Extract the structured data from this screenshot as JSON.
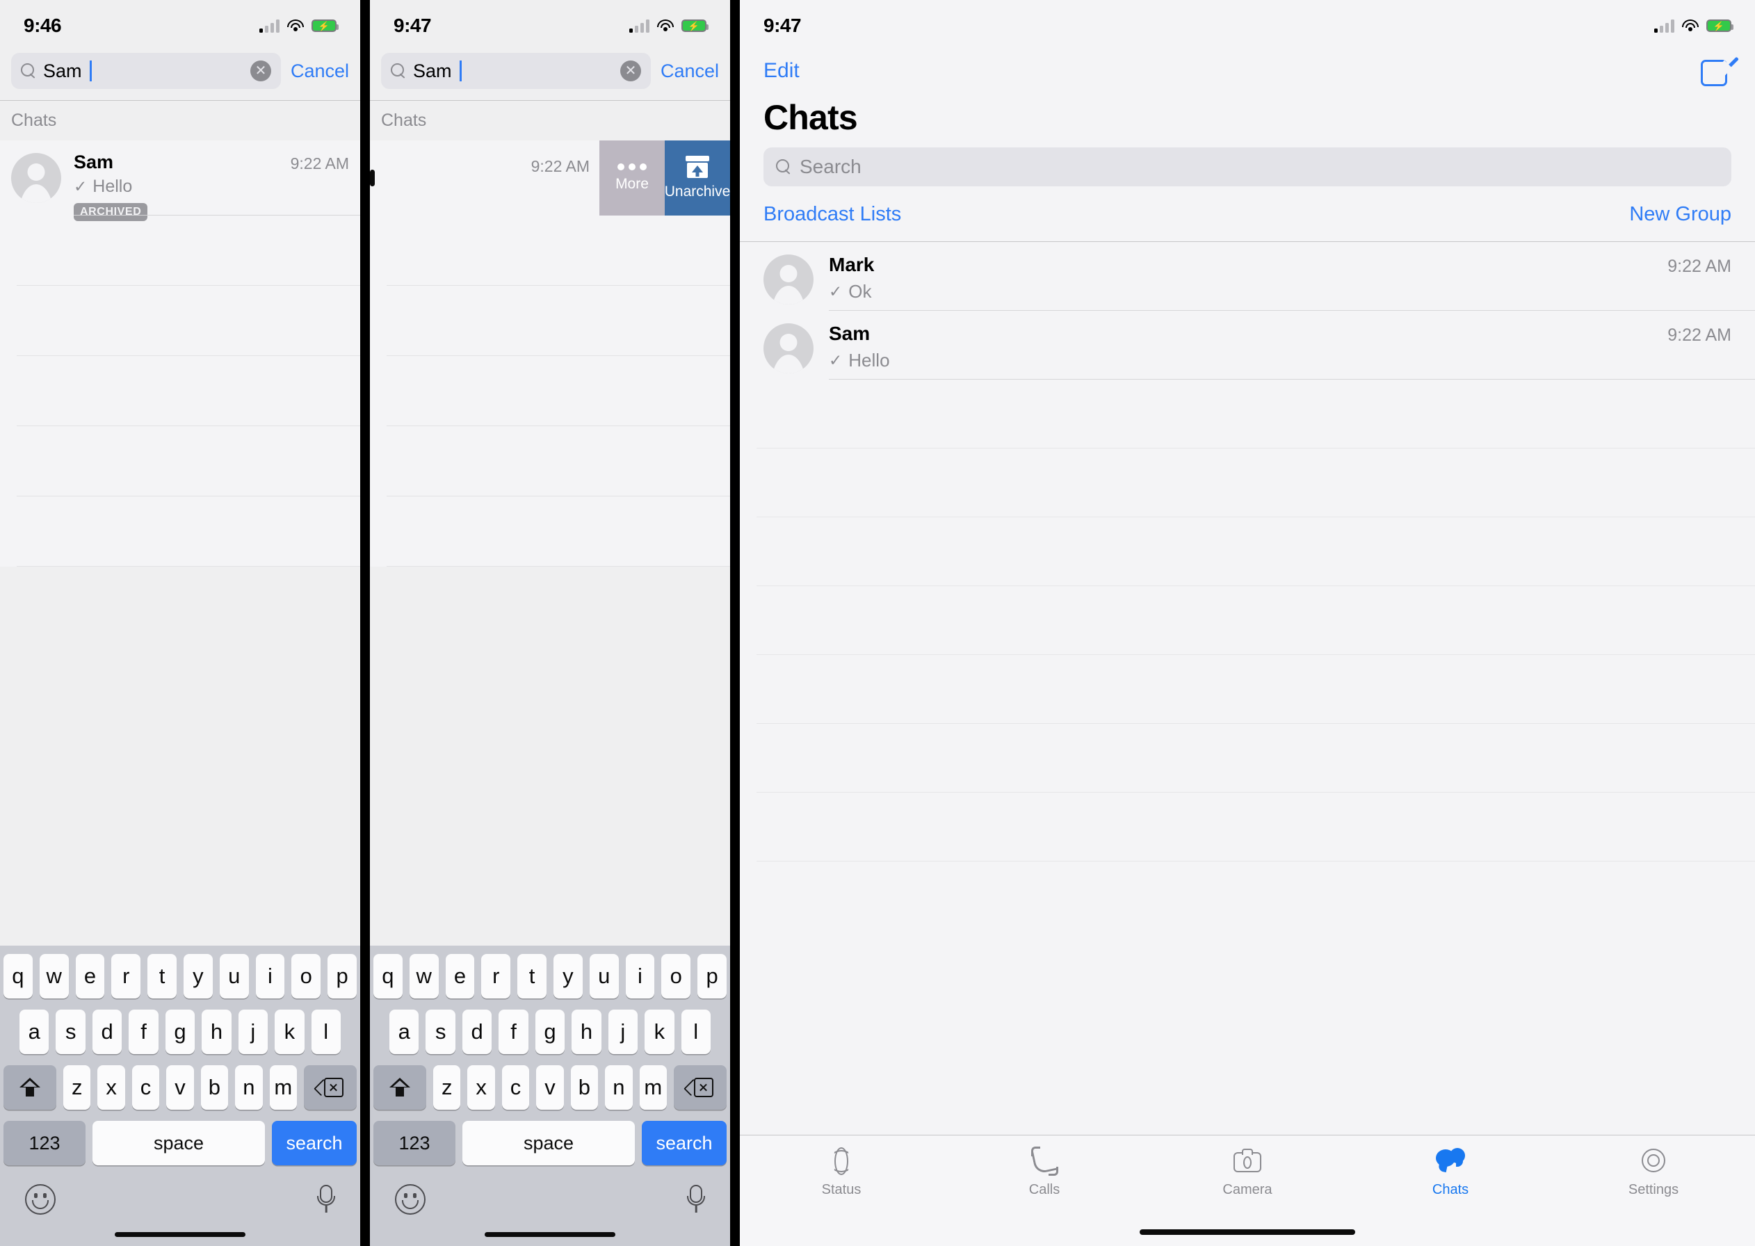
{
  "panel1": {
    "status_bar": {
      "time": "9:46",
      "cell_icon": "cellular-bars-icon",
      "wifi_icon": "wifi-icon",
      "battery_icon": "battery-charging-icon"
    },
    "search": {
      "value": "Sam",
      "icon": "search-icon",
      "clear_icon": "clear-icon",
      "cancel_label": "Cancel"
    },
    "section_header": "Chats",
    "result": {
      "name": "Sam",
      "message": "Hello",
      "tick_icon": "check-icon",
      "time": "9:22 AM",
      "badge": "ARCHIVED",
      "avatar": "person-avatar-icon"
    }
  },
  "panel2": {
    "status_bar": {
      "time": "9:47",
      "cell_icon": "cellular-bars-icon",
      "wifi_icon": "wifi-icon",
      "battery_icon": "battery-charging-icon"
    },
    "search": {
      "value": "Sam",
      "icon": "search-icon",
      "clear_icon": "clear-icon",
      "cancel_label": "Cancel"
    },
    "section_header": "Chats",
    "swiped_row": {
      "time": "9:22 AM",
      "actions": [
        {
          "label": "More",
          "icon": "ellipsis-icon",
          "color": "#bcb7c1"
        },
        {
          "label": "Unarchive",
          "icon": "unarchive-icon",
          "color": "#3c6fa8"
        }
      ]
    }
  },
  "panel3": {
    "status_bar": {
      "time": "9:47",
      "cell_icon": "cellular-bars-icon",
      "wifi_icon": "wifi-icon",
      "battery_icon": "battery-charging-icon"
    },
    "nav": {
      "edit_label": "Edit",
      "compose_icon": "compose-icon"
    },
    "title": "Chats",
    "search": {
      "placeholder": "Search",
      "icon": "search-icon"
    },
    "actions": {
      "broadcast_label": "Broadcast Lists",
      "new_group_label": "New Group"
    },
    "chats": [
      {
        "name": "Mark",
        "message": "Ok",
        "tick_icon": "check-icon",
        "time": "9:22 AM",
        "avatar": "person-avatar-icon"
      },
      {
        "name": "Sam",
        "message": "Hello",
        "tick_icon": "check-icon",
        "time": "9:22 AM",
        "avatar": "person-avatar-icon"
      }
    ],
    "tabs": [
      {
        "label": "Status",
        "icon": "status-icon",
        "active": false
      },
      {
        "label": "Calls",
        "icon": "phone-icon",
        "active": false
      },
      {
        "label": "Camera",
        "icon": "camera-icon",
        "active": false
      },
      {
        "label": "Chats",
        "icon": "chat-bubbles-icon",
        "active": true
      },
      {
        "label": "Settings",
        "icon": "gear-icon",
        "active": false
      }
    ]
  },
  "keyboard": {
    "row1": [
      "q",
      "w",
      "e",
      "r",
      "t",
      "y",
      "u",
      "i",
      "o",
      "p"
    ],
    "row2": [
      "a",
      "s",
      "d",
      "f",
      "g",
      "h",
      "j",
      "k",
      "l"
    ],
    "row3": [
      "z",
      "x",
      "c",
      "v",
      "b",
      "n",
      "m"
    ],
    "shift_icon": "shift-icon",
    "delete_icon": "backspace-icon",
    "numbers_label": "123",
    "space_label": "space",
    "search_label": "search",
    "emoji_icon": "emoji-icon",
    "mic_icon": "microphone-icon"
  },
  "colors": {
    "accent_blue": "#2f7cf6",
    "tab_active": "#1878f0",
    "unarchive_blue": "#3c6fa8",
    "more_gray": "#bcb7c1",
    "badge_gray": "#9a9a9f"
  }
}
